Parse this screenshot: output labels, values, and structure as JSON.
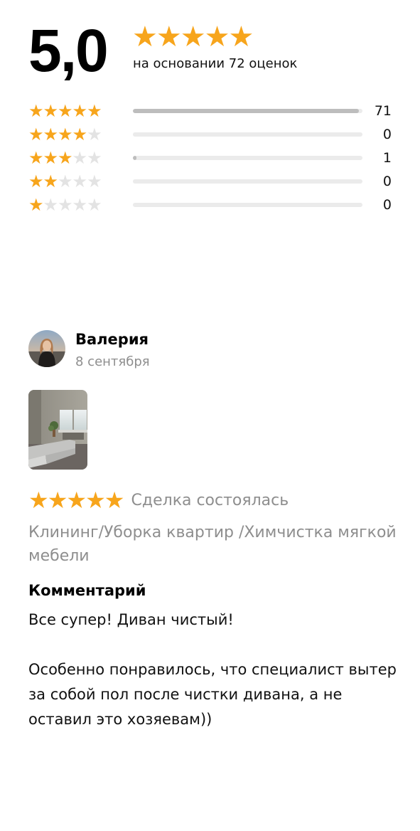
{
  "summary": {
    "score": "5,0",
    "stars_filled": 5,
    "basis_text": "на основании 72 оценок"
  },
  "distribution": [
    {
      "stars": 5,
      "count": "71",
      "fraction": 0.986
    },
    {
      "stars": 4,
      "count": "0",
      "fraction": 0
    },
    {
      "stars": 3,
      "count": "1",
      "fraction": 0.014
    },
    {
      "stars": 2,
      "count": "0",
      "fraction": 0
    },
    {
      "stars": 1,
      "count": "0",
      "fraction": 0
    }
  ],
  "review": {
    "author": "Валерия",
    "date": "8 сентября",
    "rating": 5,
    "deal_status": "Сделка состоялась",
    "service": "Клининг/Уборка квартир /Химчистка мягкой мебели",
    "comment_heading": "Комментарий",
    "comment_paragraphs": [
      "Все супер! Диван чистый!",
      "Особенно понравилось, что специалист вытер за собой пол после чистки дивана, а не оставил это хозяевам))"
    ]
  },
  "icons": {
    "star": "star-icon"
  },
  "colors": {
    "star_filled": "#F7A51C",
    "star_empty": "#E3E3E3",
    "bar_fill": "#BDBDBD",
    "bar_track": "#EBEBEB",
    "secondary_text": "#8E8E8E"
  }
}
